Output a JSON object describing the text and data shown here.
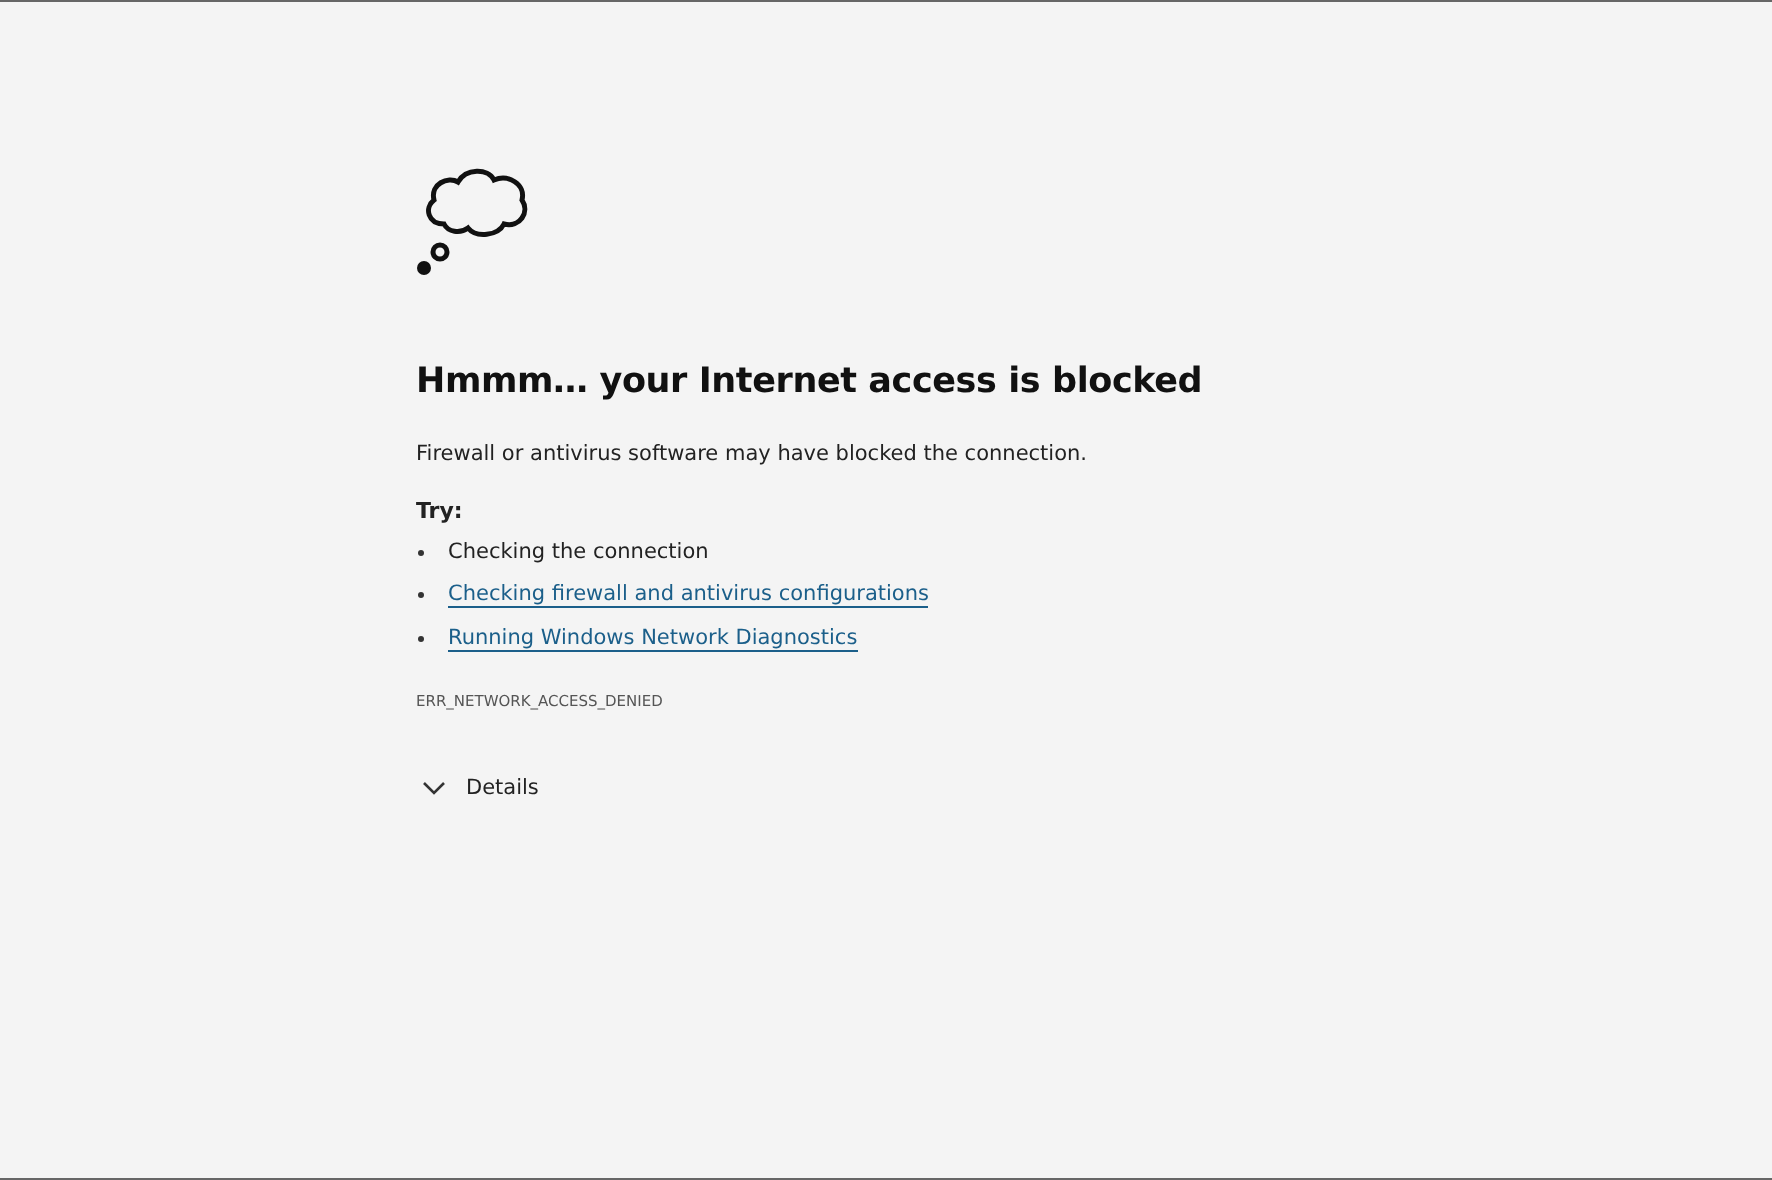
{
  "heading": "Hmmm… your Internet access is blocked",
  "description": "Firewall or antivirus software may have blocked the connection.",
  "try_label": "Try:",
  "suggestions": [
    {
      "kind": "text",
      "text": "Checking the connection"
    },
    {
      "kind": "link",
      "text": "Checking firewall and antivirus configurations"
    },
    {
      "kind": "link",
      "text": "Running Windows Network Diagnostics"
    }
  ],
  "error_code": "ERR_NETWORK_ACCESS_DENIED",
  "details": {
    "label": "Details",
    "expanded": false
  }
}
